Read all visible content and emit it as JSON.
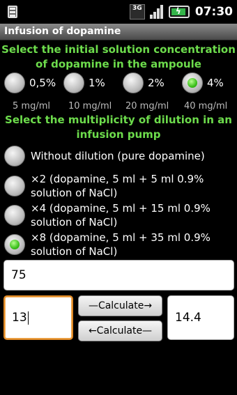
{
  "statusbar": {
    "network": "3G",
    "time": "07:30"
  },
  "app": {
    "title": "Infusion of dopamine"
  },
  "concentration": {
    "heading": "Select the initial solution concentration of dopamine in the ampoule",
    "options": [
      {
        "percent": "0,5%",
        "mg": "5 mg/ml",
        "selected": false
      },
      {
        "percent": "1%",
        "mg": "10 mg/ml",
        "selected": false
      },
      {
        "percent": "2%",
        "mg": "20 mg/ml",
        "selected": false
      },
      {
        "percent": "4%",
        "mg": "40 mg/ml",
        "selected": true
      }
    ]
  },
  "dilution": {
    "heading": "Select the multiplicity of dilution in an infusion pump",
    "options": [
      {
        "label": "Without dilution (pure dopamine)",
        "selected": false
      },
      {
        "label_line1": "×2 (dopamine, 5 ml + 5 ml 0.9%",
        "label_line2": "solution of NaCl)",
        "selected": false
      },
      {
        "label_line1": "×4 (dopamine, 5 ml + 15 ml 0.9%",
        "label_line2": "solution of NaCl)",
        "selected": false
      },
      {
        "label_line1": "×8 (dopamine, 5 ml + 35 ml 0.9%",
        "label_line2": "solution of NaCl)",
        "selected": true
      }
    ]
  },
  "inputs": {
    "weight_value": "75",
    "left_value": "13",
    "right_value": "14.4"
  },
  "buttons": {
    "calc_forward": "—Calculate→",
    "calc_back": "←Calculate—"
  },
  "colors": {
    "heading": "#6ddc4c",
    "focus": "#e08a27",
    "radio_on": "#3bc01a"
  }
}
